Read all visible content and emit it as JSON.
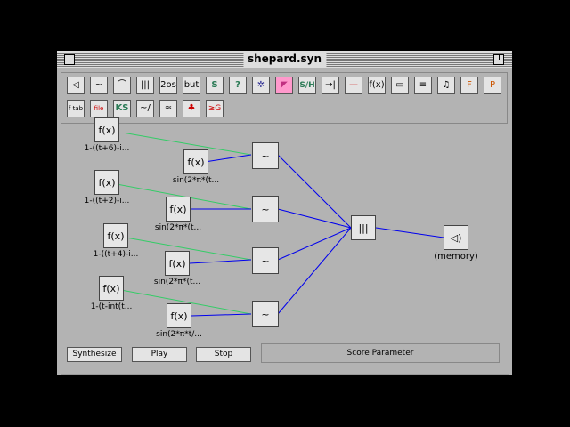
{
  "window": {
    "title": "shepard.syn"
  },
  "palette": {
    "row1": [
      "◁",
      "~",
      "⌒",
      "|||",
      "2os",
      "but",
      "S",
      "?",
      "✲",
      "◤",
      "S/H",
      "→|",
      "—",
      "f(x)",
      "▭",
      "≡",
      "♫",
      "F",
      "P"
    ],
    "row2": [
      "f tab",
      "file",
      "KS",
      "~/",
      "≈",
      "♣",
      "≥G"
    ]
  },
  "nodes": {
    "f1_label": "1-((t+6)-i...",
    "f2_label": "1-((t+2)-i...",
    "f3_label": "1-((t+4)-i...",
    "f4_label": "1-(t-int(t...",
    "s1_label": "sin(2*π*(t...",
    "s2_label": "sin(2*π*(t...",
    "s3_label": "sin(2*π*(t...",
    "s4_label": "sin(2*π*t/...",
    "fx": "f(x)",
    "osc": "~",
    "mixer": "|||",
    "speaker": "◁)",
    "output_label": "(memory)"
  },
  "buttons": {
    "synthesize": "Synthesize",
    "play": "Play",
    "stop": "Stop"
  },
  "score_parameter": "Score Parameter"
}
